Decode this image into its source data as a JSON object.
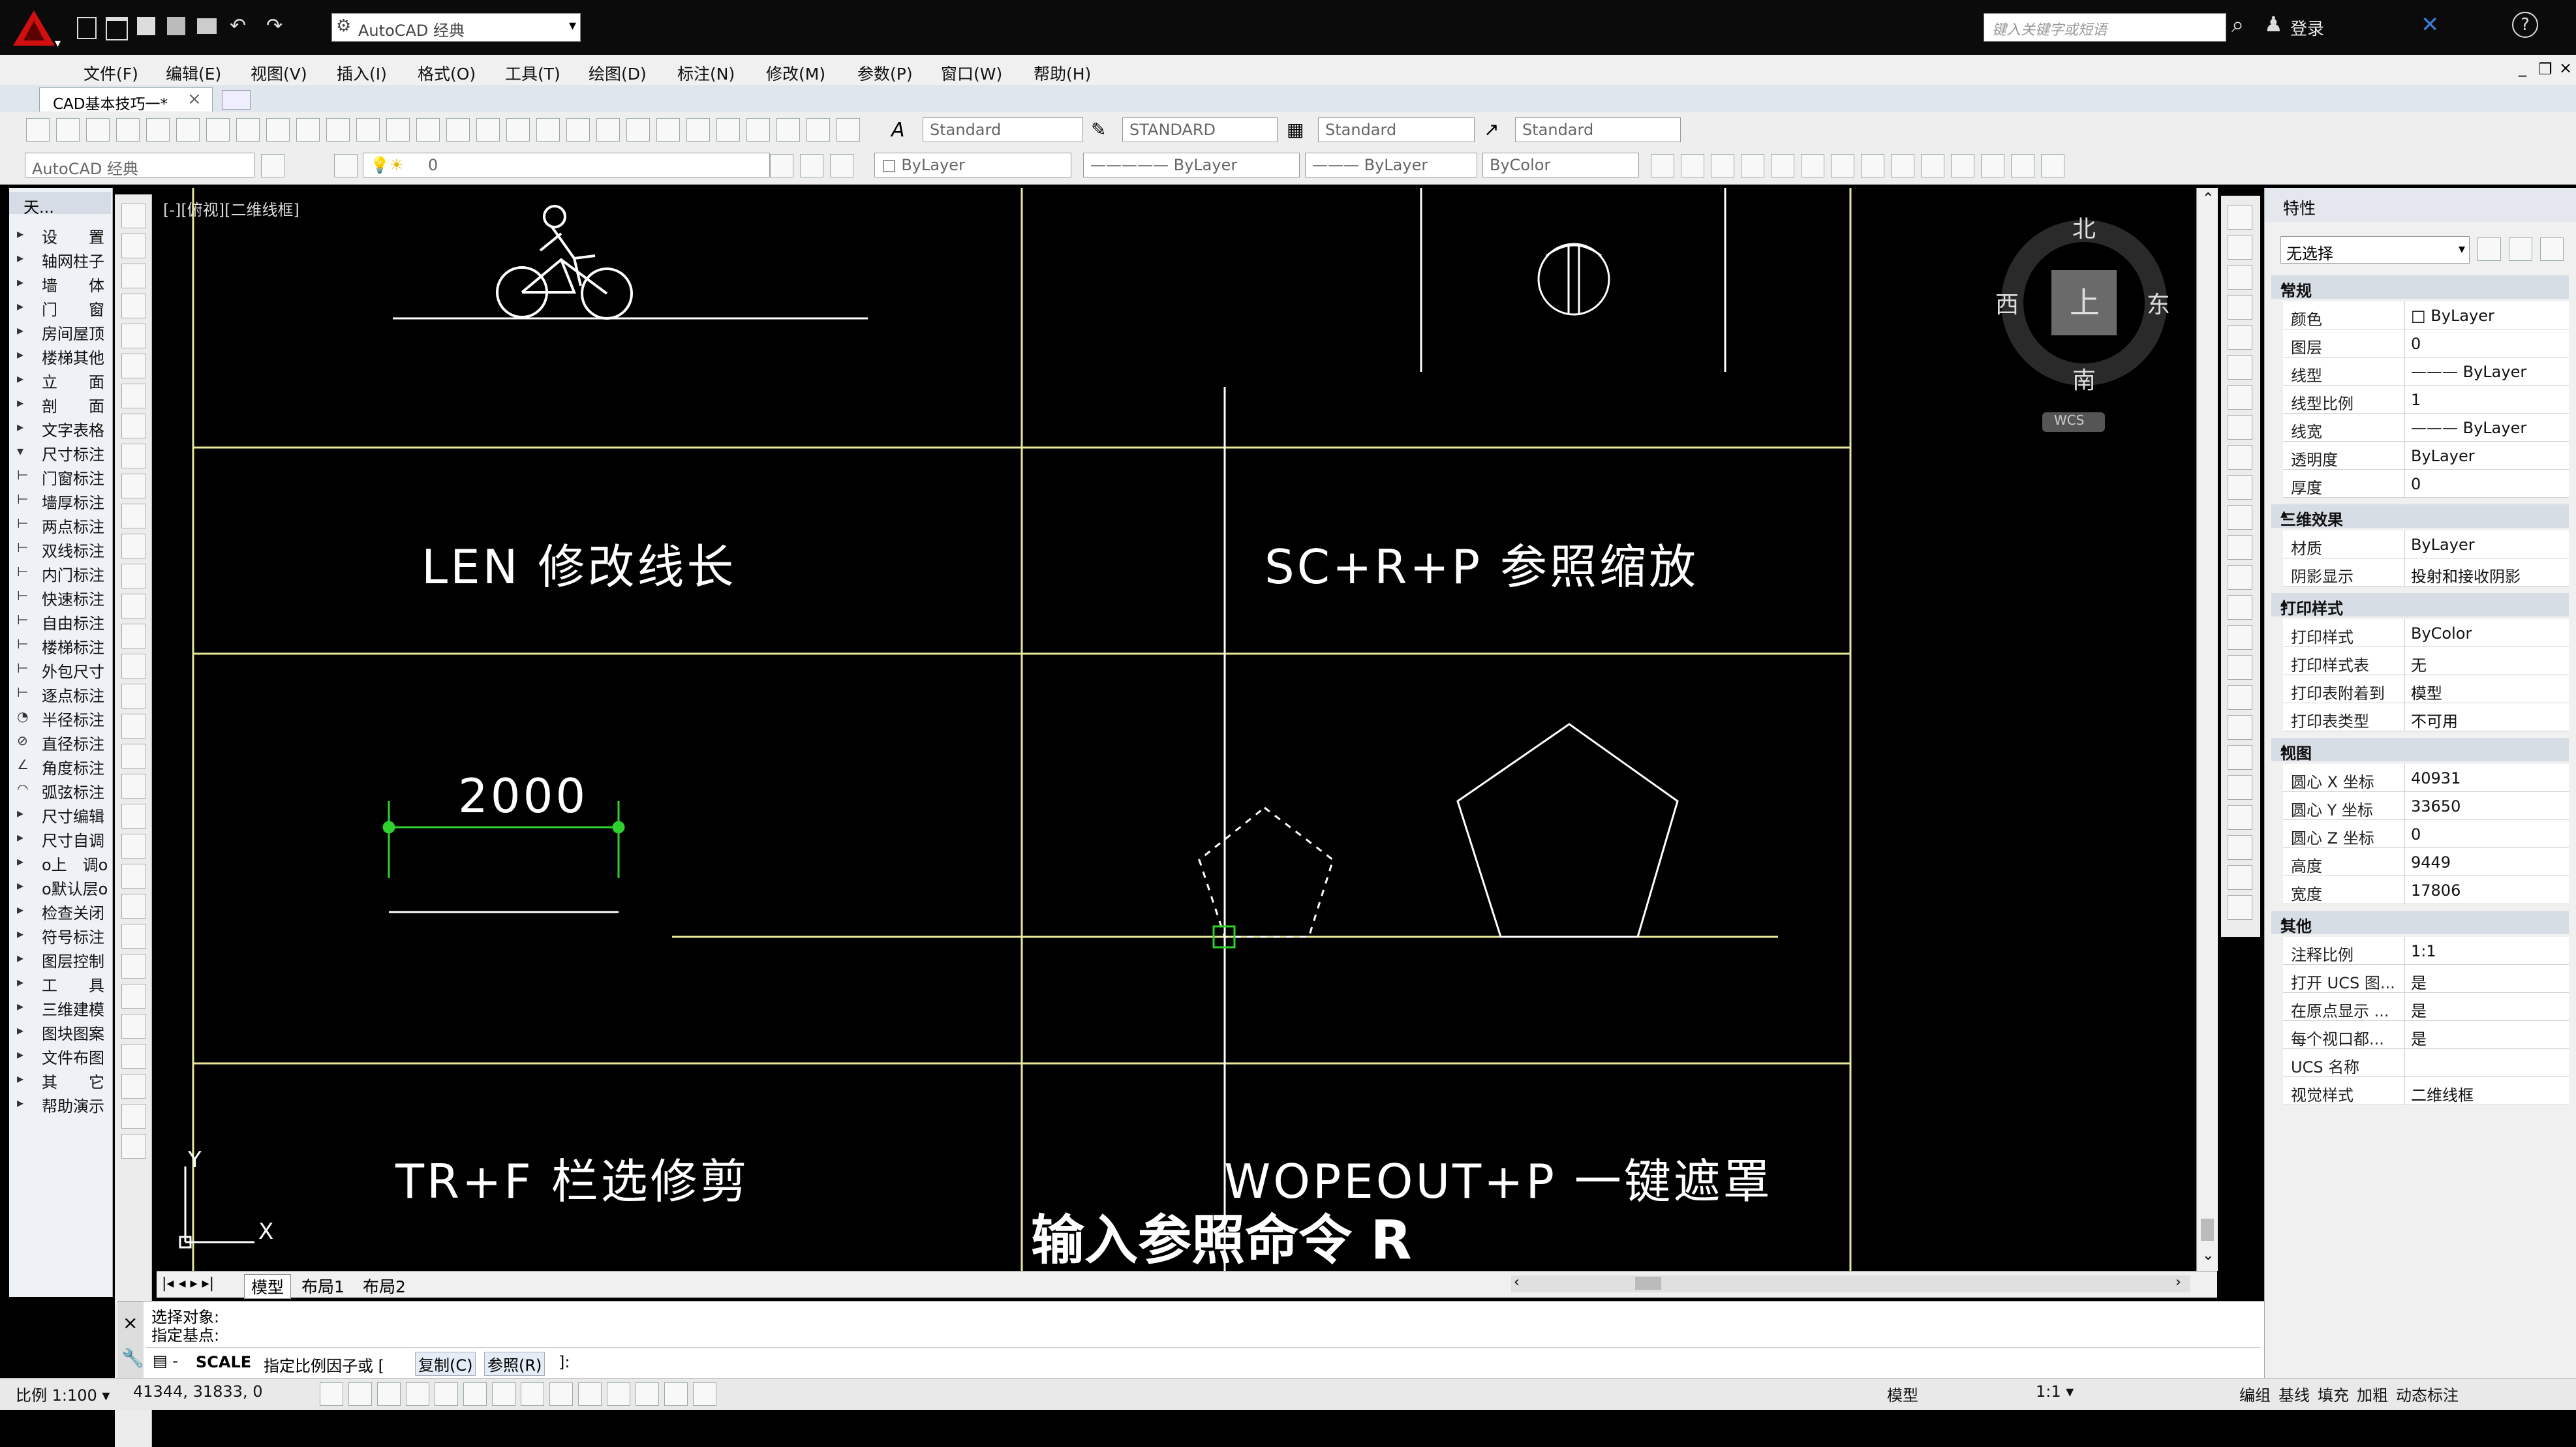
{
  "app": {
    "workspace_combo": "AutoCAD 经典",
    "search_placeholder": "键入关键字或短语",
    "login": "登录",
    "help": "?"
  },
  "menu": [
    "文件(F)",
    "编辑(E)",
    "视图(V)",
    "插入(I)",
    "格式(O)",
    "工具(T)",
    "绘图(D)",
    "标注(N)",
    "修改(M)",
    "参数(P)",
    "窗口(W)",
    "帮助(H)"
  ],
  "doc_tab": {
    "label": "CAD基本技巧一*",
    "close": "×"
  },
  "styles": {
    "text_style": "Standard",
    "dim_style": "STANDARD",
    "table_style": "Standard",
    "mleader_style": "Standard"
  },
  "layers": {
    "workspace": "AutoCAD 经典",
    "layer": "0",
    "color": "ByLayer",
    "linetype": "ByLayer",
    "lineweight": "ByLayer",
    "plotstyle": "ByColor"
  },
  "tool_palette": {
    "header": "天...",
    "items": [
      {
        "icon": "▸",
        "label": "设　　置",
        "ico_name": "expand-arrow-icon"
      },
      {
        "icon": "▸",
        "label": "轴网柱子",
        "ico_name": "expand-arrow-icon"
      },
      {
        "icon": "▸",
        "label": "墙　　体",
        "ico_name": "expand-arrow-icon"
      },
      {
        "icon": "▸",
        "label": "门　　窗",
        "ico_name": "expand-arrow-icon"
      },
      {
        "icon": "▸",
        "label": "房间屋顶",
        "ico_name": "expand-arrow-icon"
      },
      {
        "icon": "▸",
        "label": "楼梯其他",
        "ico_name": "expand-arrow-icon"
      },
      {
        "icon": "▸",
        "label": "立　　面",
        "ico_name": "expand-arrow-icon"
      },
      {
        "icon": "▸",
        "label": "剖　　面",
        "ico_name": "expand-arrow-icon"
      },
      {
        "icon": "▸",
        "label": "文字表格",
        "ico_name": "expand-arrow-icon"
      },
      {
        "icon": "▾",
        "label": "尺寸标注",
        "ico_name": "collapse-arrow-icon"
      },
      {
        "icon": "⊢",
        "label": "门窗标注",
        "ico_name": "dim-icon"
      },
      {
        "icon": "⊢",
        "label": "墙厚标注",
        "ico_name": "dim-icon"
      },
      {
        "icon": "⊢",
        "label": "两点标注",
        "ico_name": "dim-icon"
      },
      {
        "icon": "⊢",
        "label": "双线标注",
        "ico_name": "dim-icon"
      },
      {
        "icon": "⊢",
        "label": "内门标注",
        "ico_name": "dim-icon"
      },
      {
        "icon": "⊢",
        "label": "快速标注",
        "ico_name": "dim-icon"
      },
      {
        "icon": "⊢",
        "label": "自由标注",
        "ico_name": "dim-icon"
      },
      {
        "icon": "⊢",
        "label": "楼梯标注",
        "ico_name": "dim-icon"
      },
      {
        "icon": "⊢",
        "label": "外包尺寸",
        "ico_name": "dim-icon"
      },
      {
        "icon": "⊢",
        "label": "逐点标注",
        "ico_name": "dim-icon"
      },
      {
        "icon": "◔",
        "label": "半径标注",
        "ico_name": "radius-icon"
      },
      {
        "icon": "⊘",
        "label": "直径标注",
        "ico_name": "diameter-icon"
      },
      {
        "icon": "∠",
        "label": "角度标注",
        "ico_name": "angle-icon"
      },
      {
        "icon": "◠",
        "label": "弧弦标注",
        "ico_name": "arc-icon"
      },
      {
        "icon": "▸",
        "label": "尺寸编辑",
        "ico_name": "expand-arrow-icon"
      },
      {
        "icon": "▸",
        "label": "尺寸自调",
        "ico_name": "expand-arrow-icon"
      },
      {
        "icon": "▸",
        "label": "o上　调o",
        "ico_name": "expand-arrow-icon"
      },
      {
        "icon": "▸",
        "label": "o默认层o",
        "ico_name": "expand-arrow-icon"
      },
      {
        "icon": "▸",
        "label": "检查关闭",
        "ico_name": "expand-arrow-icon"
      },
      {
        "icon": "▸",
        "label": "符号标注",
        "ico_name": "expand-arrow-icon"
      },
      {
        "icon": "▸",
        "label": "图层控制",
        "ico_name": "expand-arrow-icon"
      },
      {
        "icon": "▸",
        "label": "工　　具",
        "ico_name": "expand-arrow-icon"
      },
      {
        "icon": "▸",
        "label": "三维建模",
        "ico_name": "expand-arrow-icon"
      },
      {
        "icon": "▸",
        "label": "图块图案",
        "ico_name": "expand-arrow-icon"
      },
      {
        "icon": "▸",
        "label": "文件布图",
        "ico_name": "expand-arrow-icon"
      },
      {
        "icon": "▸",
        "label": "其　　它",
        "ico_name": "expand-arrow-icon"
      },
      {
        "icon": "▸",
        "label": "帮助演示",
        "ico_name": "expand-arrow-icon"
      }
    ]
  },
  "viewport": {
    "label": "[-][俯视][二维线框]",
    "texts": {
      "len": "LEN 修改线长",
      "scrp": "SC+R+P 参照缩放",
      "dim_value": "2000",
      "trf": "TR+F 栏选修剪",
      "wipeout": "WOPEOUT+P 一键遮罩"
    },
    "subtitle": "输入参照命令 R",
    "ucs": {
      "x": "X",
      "y": "Y"
    },
    "viewcube": {
      "north": "北",
      "south": "南",
      "east": "东",
      "west": "西",
      "top": "上",
      "wcs": "WCS"
    }
  },
  "layout_tabs": [
    "模型",
    "布局1",
    "布局2"
  ],
  "properties": {
    "title": "特性",
    "selection": "无选择",
    "sections": [
      {
        "title": "常规",
        "rows": [
          {
            "k": "颜色",
            "v": "□ ByLayer"
          },
          {
            "k": "图层",
            "v": "0"
          },
          {
            "k": "线型",
            "v": "——— ByLayer"
          },
          {
            "k": "线型比例",
            "v": "1"
          },
          {
            "k": "线宽",
            "v": "——— ByLayer"
          },
          {
            "k": "透明度",
            "v": "ByLayer"
          },
          {
            "k": "厚度",
            "v": "0"
          }
        ]
      },
      {
        "title": "三维效果",
        "rows": [
          {
            "k": "材质",
            "v": "ByLayer"
          },
          {
            "k": "阴影显示",
            "v": "投射和接收阴影"
          }
        ]
      },
      {
        "title": "打印样式",
        "rows": [
          {
            "k": "打印样式",
            "v": "ByColor"
          },
          {
            "k": "打印样式表",
            "v": "无"
          },
          {
            "k": "打印表附着到",
            "v": "模型"
          },
          {
            "k": "打印表类型",
            "v": "不可用"
          }
        ]
      },
      {
        "title": "视图",
        "rows": [
          {
            "k": "圆心 X 坐标",
            "v": "40931"
          },
          {
            "k": "圆心 Y 坐标",
            "v": "33650"
          },
          {
            "k": "圆心 Z 坐标",
            "v": "0"
          },
          {
            "k": "高度",
            "v": "9449"
          },
          {
            "k": "宽度",
            "v": "17806"
          }
        ]
      },
      {
        "title": "其他",
        "rows": [
          {
            "k": "注释比例",
            "v": "1:1"
          },
          {
            "k": "打开 UCS 图...",
            "v": "是"
          },
          {
            "k": "在原点显示 ...",
            "v": "是"
          },
          {
            "k": "每个视口都...",
            "v": "是"
          },
          {
            "k": "UCS 名称",
            "v": ""
          },
          {
            "k": "视觉样式",
            "v": "二维线框"
          }
        ]
      }
    ]
  },
  "command": {
    "history1": "选择对象:",
    "history2": "指定基点:",
    "prompt_cmd": "SCALE",
    "prompt_text": "指定比例因子或 [",
    "opt1": "复制(C)",
    "opt2": "参照(R)",
    "prompt_end": "]:"
  },
  "status": {
    "scale": "比例 1:100 ▾",
    "coords": "41344, 31833, 0",
    "model": "模型",
    "anno_scale": "1:1 ▾",
    "right_items": [
      "编组",
      "基线",
      "填充",
      "加粗",
      "动态标注"
    ]
  },
  "colors": {
    "accent": "#c00000",
    "grid_line": "#e8e89a",
    "dim_green": "#2fd12f"
  }
}
